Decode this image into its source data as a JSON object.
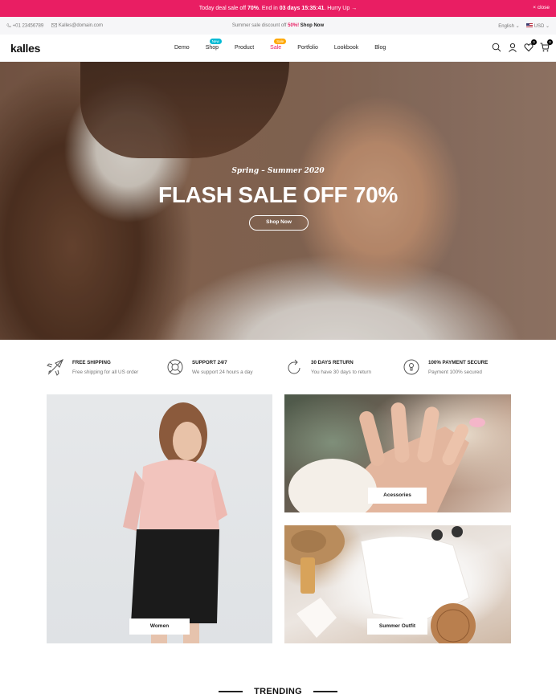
{
  "promo": {
    "before": "Today deal sale off ",
    "percent": "70%",
    "mid": ". End in ",
    "days": "03 days",
    "time": "15:35:41",
    "after": ". Hurry Up →",
    "close": "× close"
  },
  "topbar": {
    "phone": "+01 23456789",
    "email": "Kalles@domain.com",
    "summer_text": "Summer sale discount off ",
    "summer_pct": "50%!",
    "shop_now": "Shop Now",
    "language": "English",
    "currency": "USD"
  },
  "header": {
    "logo": "kalles",
    "nav": [
      {
        "label": "Demo"
      },
      {
        "label": "Shop",
        "badge": "New"
      },
      {
        "label": "Product"
      },
      {
        "label": "Sale",
        "badge": "Sale"
      },
      {
        "label": "Portfolio"
      },
      {
        "label": "Lookbook"
      },
      {
        "label": "Blog"
      }
    ],
    "wishlist_count": "0",
    "cart_count": "0"
  },
  "hero": {
    "subtitle": "Spring – Summer 2020",
    "title": "FLASH SALE OFF 70%",
    "button": "Shop Now"
  },
  "features": [
    {
      "icon": "airplane-icon",
      "title": "FREE SHIPPING",
      "desc": "Free shipping for all US order"
    },
    {
      "icon": "lifebuoy-icon",
      "title": "SUPPORT 24/7",
      "desc": "We support 24 hours a day"
    },
    {
      "icon": "refresh-icon",
      "title": "30 DAYS RETURN",
      "desc": "You have 30 days to return"
    },
    {
      "icon": "lock-icon",
      "title": "100% PAYMENT SECURE",
      "desc": "Payment 100% secured"
    }
  ],
  "categories": {
    "women": "Women",
    "accessories": "Acessories",
    "summer": "Summer Outfit"
  },
  "trending": "TRENDING",
  "colors": {
    "accent": "#e91e63",
    "new_badge": "#01bad4",
    "sale_badge": "#ffa800"
  }
}
